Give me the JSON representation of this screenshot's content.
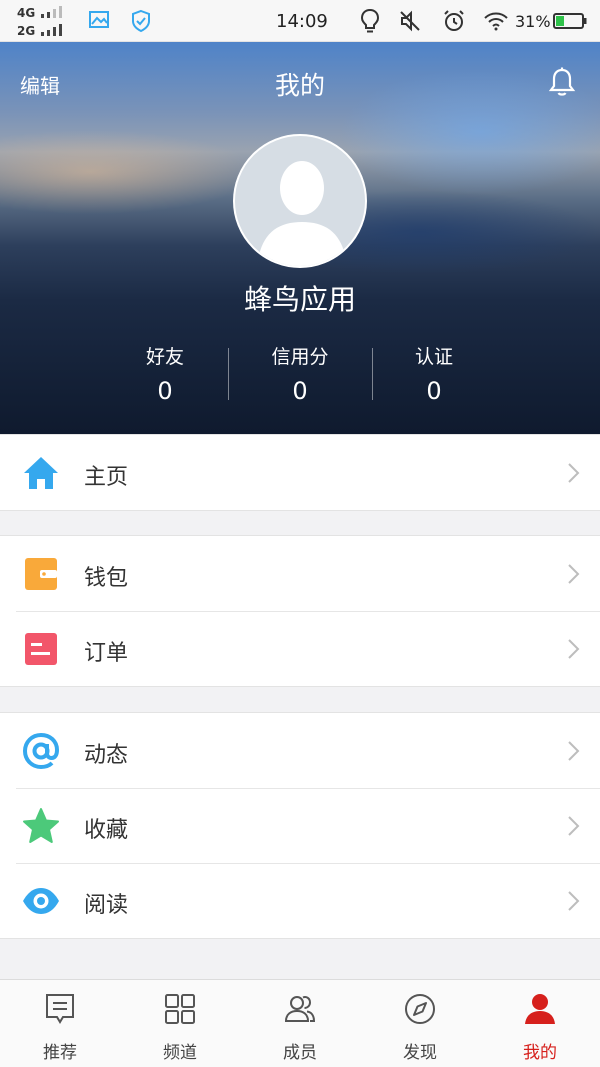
{
  "status_bar": {
    "network_1": "4G",
    "network_2": "2G",
    "time": "14:09",
    "battery": "31%"
  },
  "header": {
    "edit": "编辑",
    "title": "我的",
    "username": "蜂鸟应用",
    "stats": [
      {
        "label": "好友",
        "value": "0"
      },
      {
        "label": "信用分",
        "value": "0"
      },
      {
        "label": "认证",
        "value": "0"
      }
    ]
  },
  "menu": {
    "home": {
      "label": "主页",
      "icon": "home-icon",
      "color": "#35a8ee"
    },
    "wallet": {
      "label": "钱包",
      "icon": "wallet-icon",
      "color": "#f9a93a"
    },
    "orders": {
      "label": "订单",
      "icon": "order-icon",
      "color": "#f2566a"
    },
    "dynamics": {
      "label": "动态",
      "icon": "at-icon",
      "color": "#35a8ee"
    },
    "favorites": {
      "label": "收藏",
      "icon": "star-icon",
      "color": "#4cc97a"
    },
    "reading": {
      "label": "阅读",
      "icon": "eye-icon",
      "color": "#35a8ee"
    }
  },
  "tabs": [
    {
      "label": "推荐",
      "icon": "recommend-icon",
      "active": false
    },
    {
      "label": "频道",
      "icon": "channels-icon",
      "active": false
    },
    {
      "label": "成员",
      "icon": "members-icon",
      "active": false
    },
    {
      "label": "发现",
      "icon": "discover-icon",
      "active": false
    },
    {
      "label": "我的",
      "icon": "profile-icon",
      "active": true
    }
  ],
  "colors": {
    "accent": "#d6201c",
    "icon_blue": "#35a8ee",
    "background": "#f2f2f4"
  }
}
